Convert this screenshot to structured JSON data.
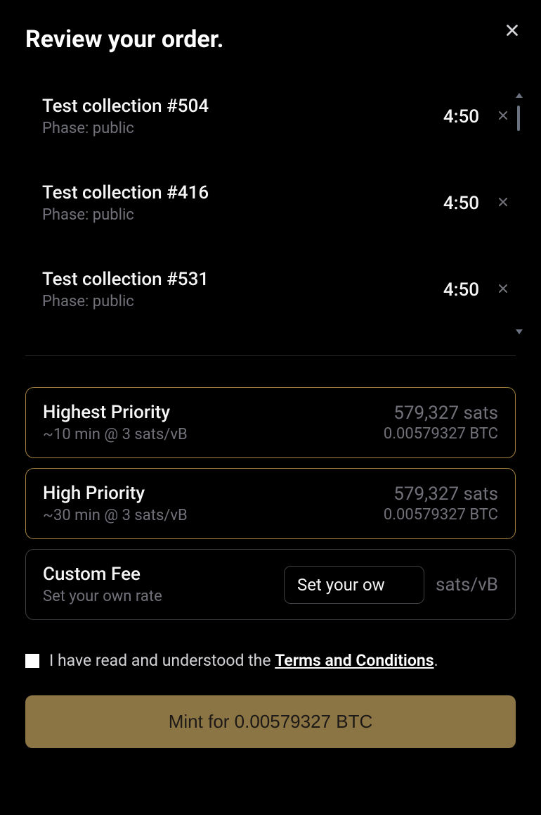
{
  "header": {
    "title": "Review your order."
  },
  "orders": [
    {
      "title": "Test collection #504",
      "phase": "Phase: public",
      "time": "4:50"
    },
    {
      "title": "Test collection #416",
      "phase": "Phase: public",
      "time": "4:50"
    },
    {
      "title": "Test collection #531",
      "phase": "Phase: public",
      "time": "4:50"
    }
  ],
  "priorities": [
    {
      "title": "Highest Priority",
      "sub": "~10 min @ 3 sats/vB",
      "sats": "579,327 sats",
      "btc": "0.00579327 BTC",
      "highlighted": true
    },
    {
      "title": "High Priority",
      "sub": "~30 min @ 3 sats/vB",
      "sats": "579,327 sats",
      "btc": "0.00579327 BTC",
      "highlighted": true
    }
  ],
  "custom": {
    "title": "Custom Fee",
    "sub": "Set your own rate",
    "placeholder": "Set your ow",
    "unit": "sats/vB"
  },
  "terms": {
    "prefix": "I have read and understood the ",
    "link": "Terms and Conditions",
    "suffix": "."
  },
  "mint": {
    "label": "Mint for 0.00579327 BTC"
  }
}
